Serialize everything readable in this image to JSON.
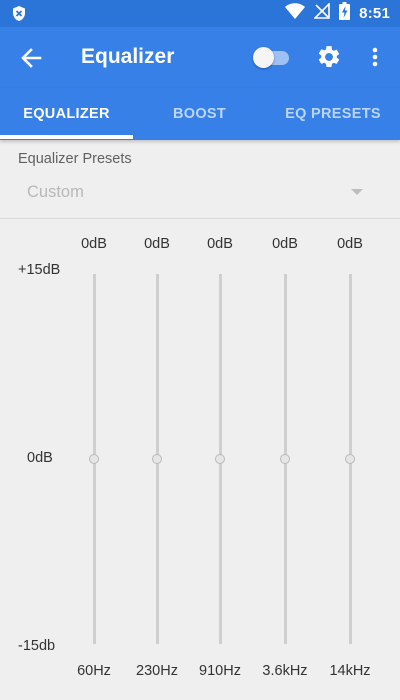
{
  "status_bar": {
    "time": "8:51",
    "icons": [
      "shield-notification-icon",
      "wifi-icon",
      "no-signal-icon",
      "battery-charging-icon"
    ]
  },
  "toolbar": {
    "title": "Equalizer",
    "back_icon": "arrow-back-icon",
    "enable_toggle_on": false,
    "settings_icon": "gear-icon",
    "more_icon": "more-vert-icon"
  },
  "tabs": [
    {
      "label": "EQUALIZER",
      "active": true
    },
    {
      "label": "BOOST",
      "active": false
    },
    {
      "label": "EQ PRESETS",
      "active": false
    }
  ],
  "presets": {
    "label": "Equalizer Presets",
    "selected": "Custom"
  },
  "eq": {
    "max_label": "+15dB",
    "mid_label": "0dB",
    "min_label": "-15db",
    "range_db": [
      -15,
      15
    ],
    "bands": [
      {
        "freq": "60Hz",
        "gain_label": "0dB",
        "gain_db": 0
      },
      {
        "freq": "230Hz",
        "gain_label": "0dB",
        "gain_db": 0
      },
      {
        "freq": "910Hz",
        "gain_label": "0dB",
        "gain_db": 0
      },
      {
        "freq": "3.6kHz",
        "gain_label": "0dB",
        "gain_db": 0
      },
      {
        "freq": "14kHz",
        "gain_label": "0dB",
        "gain_db": 0
      }
    ]
  },
  "colors": {
    "primary": "#3680e8",
    "status_bar": "#2b74d8",
    "background": "#efefef"
  }
}
